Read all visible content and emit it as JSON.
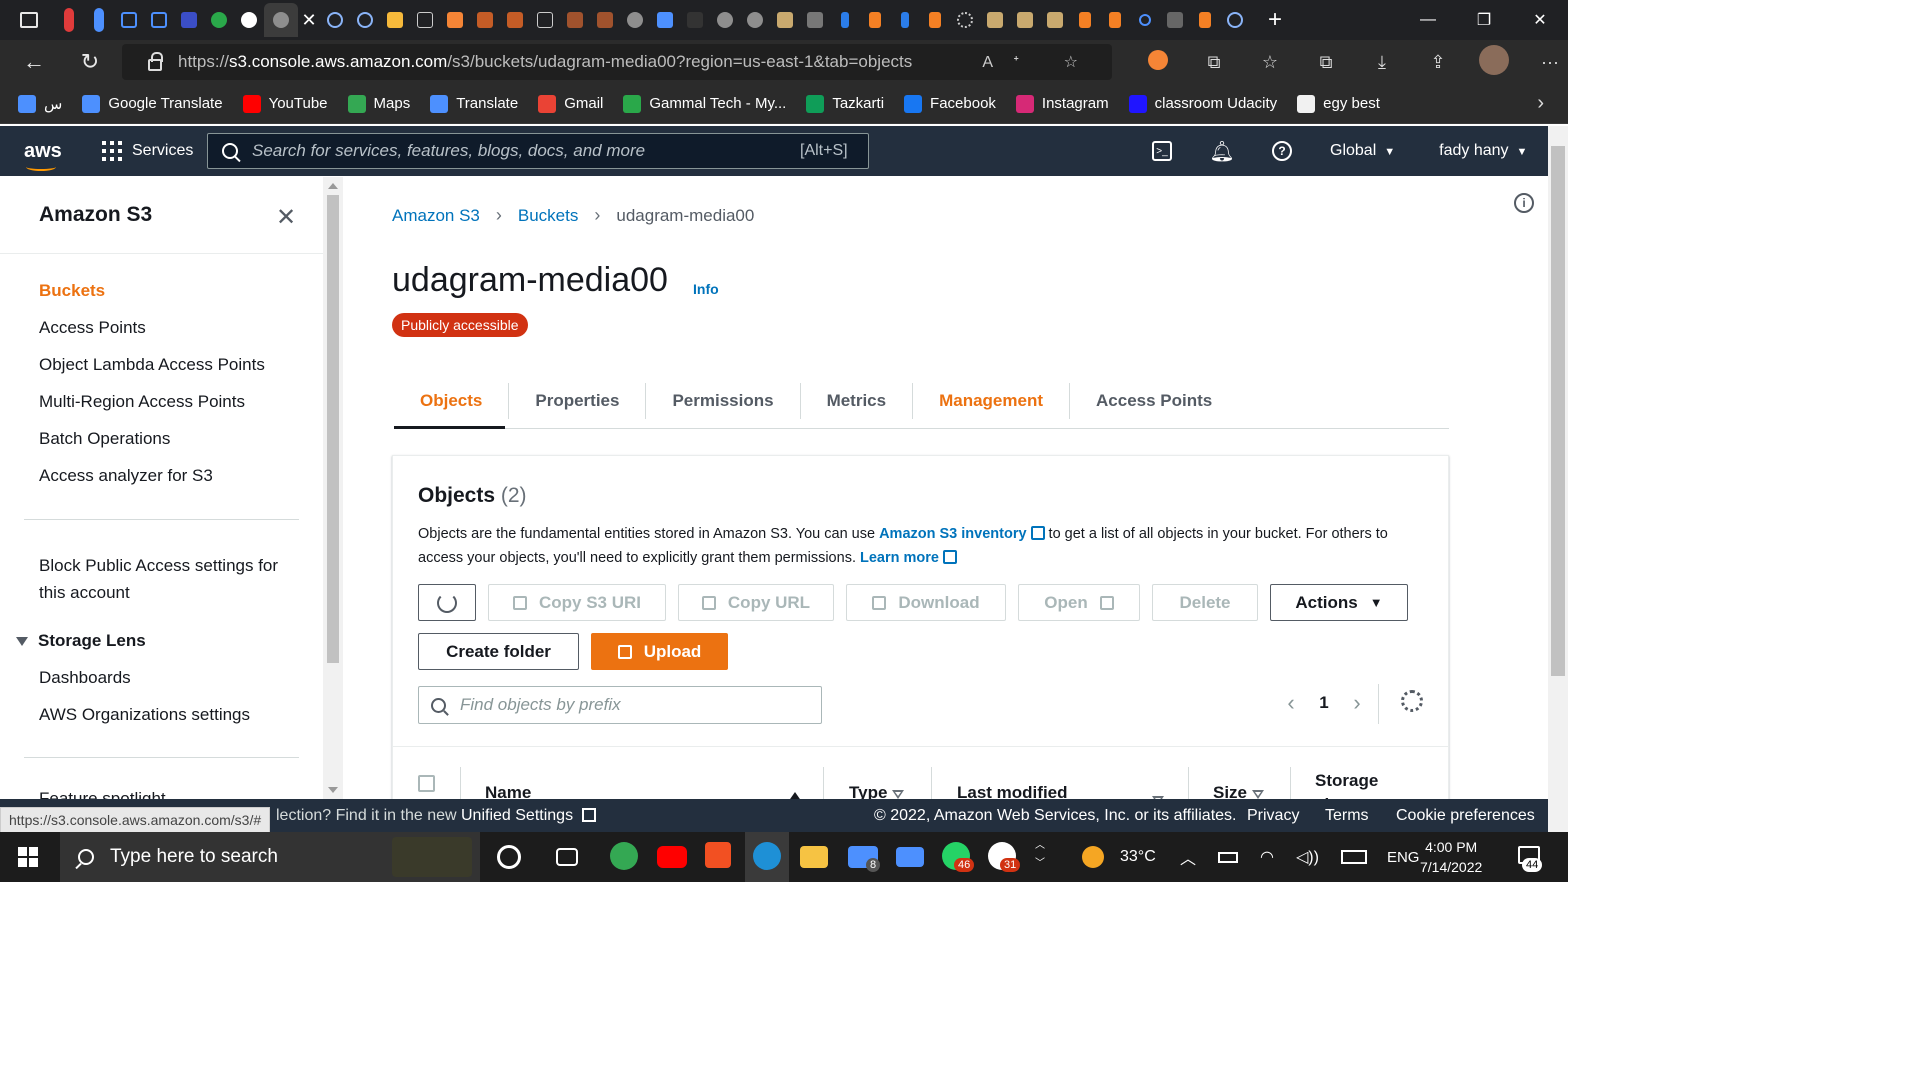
{
  "browser": {
    "url_scheme": "https://",
    "url_host": "s3.console.aws.amazon.com",
    "url_path": "/s3/buckets/udagram-media00?region=us-east-1&tab=objects",
    "status_url": "https://s3.console.aws.amazon.com/s3/#",
    "tab_colors": [
      "#e03b3b",
      "#4d90fe",
      "#1a73e8",
      "#3b4ec7",
      "#4f46e5",
      "#2aa84a",
      "#ffffff",
      "#8e8e8e"
    ],
    "bookmarks": [
      {
        "label": "س",
        "color": "#4d90fe"
      },
      {
        "label": "Google Translate",
        "color": "#4d90fe"
      },
      {
        "label": "YouTube",
        "color": "#ff0000"
      },
      {
        "label": "Maps",
        "color": "#34a853"
      },
      {
        "label": "Translate",
        "color": "#4d90fe"
      },
      {
        "label": "Gmail",
        "color": "#ea4335"
      },
      {
        "label": "Gammal Tech - My...",
        "color": "#2aa84a"
      },
      {
        "label": "Tazkarti",
        "color": "#0f9d58"
      },
      {
        "label": "Facebook",
        "color": "#1877f2"
      },
      {
        "label": "Instagram",
        "color": "#d62976"
      },
      {
        "label": "classroom Udacity",
        "color": "#2015ff"
      },
      {
        "label": "egy best",
        "color": "#f1f1f1"
      }
    ]
  },
  "aws_header": {
    "logo": "aws",
    "services": "Services",
    "search_placeholder": "Search for services, features, blogs, docs, and more",
    "search_shortcut": "[Alt+S]",
    "region": "Global",
    "user": "fady hany"
  },
  "sidebar": {
    "title": "Amazon S3",
    "items": [
      "Buckets",
      "Access Points",
      "Object Lambda Access Points",
      "Multi-Region Access Points",
      "Batch Operations",
      "Access analyzer for S3"
    ],
    "block_public_1": "Block Public Access settings for",
    "block_public_2": "this account",
    "storage_lens": "Storage Lens",
    "storage_items": [
      "Dashboards",
      "AWS Organizations settings"
    ],
    "partial_item": "Feature spotlight"
  },
  "breadcrumb": [
    "Amazon S3",
    "Buckets",
    "udagram-media00"
  ],
  "bucket": {
    "name": "udagram-media00",
    "info": "Info",
    "badge": "Publicly accessible"
  },
  "tabs": [
    "Objects",
    "Properties",
    "Permissions",
    "Metrics",
    "Management",
    "Access Points"
  ],
  "objects_panel": {
    "title": "Objects",
    "count": "(2)",
    "desc_1": "Objects are the fundamental entities stored in Amazon S3. You can use ",
    "desc_link_1": "Amazon S3 inventory",
    "desc_2": " to get a list of all objects in your bucket. For others to access your objects, you'll need to explicitly grant them permissions. ",
    "desc_link_2": "Learn more",
    "buttons": {
      "copy_uri": "Copy S3 URI",
      "copy_url": "Copy URL",
      "download": "Download",
      "open": "Open",
      "delete": "Delete",
      "actions": "Actions",
      "create_folder": "Create folder",
      "upload": "Upload"
    },
    "search_placeholder": "Find objects by prefix",
    "page": "1",
    "columns": [
      "Name",
      "Type",
      "Last modified",
      "Size",
      "Storage class"
    ]
  },
  "footer": {
    "feedback_partial": "lection? Find it in the new ",
    "unified": "Unified Settings",
    "copyright": "© 2022, Amazon Web Services, Inc. or its affiliates.",
    "privacy": "Privacy",
    "terms": "Terms",
    "cookies": "Cookie preferences"
  },
  "taskbar": {
    "search_placeholder": "Type here to search",
    "mail_badge": "8",
    "whatsapp_badge": "46",
    "slack_badge": "31",
    "temperature": "33°C",
    "language": "ENG",
    "time": "4:00 PM",
    "date": "7/14/2022",
    "notifications": "44"
  }
}
